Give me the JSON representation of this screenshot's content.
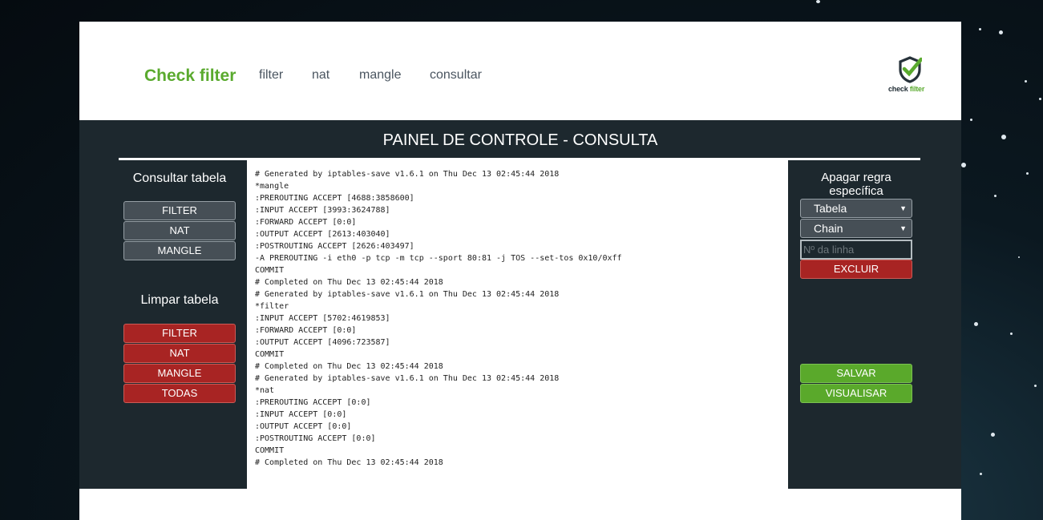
{
  "nav": {
    "brand": "Check filter",
    "links": [
      "filter",
      "nat",
      "mangle",
      "consultar"
    ],
    "logo": {
      "icon": "shield-check-icon",
      "text_dark": "check",
      "text_green": "filter"
    }
  },
  "panel": {
    "title": "PAINEL DE CONTROLE - CONSULTA",
    "consultar": {
      "heading": "Consultar tabela",
      "buttons": [
        "FILTER",
        "NAT",
        "MANGLE"
      ]
    },
    "limpar": {
      "heading": "Limpar tabela",
      "buttons": [
        "FILTER",
        "NAT",
        "MANGLE",
        "TODAS"
      ]
    },
    "apagar": {
      "heading": "Apagar regra específica",
      "tabela_select": "Tabela",
      "chain_select": "Chain",
      "linha_placeholder": "Nº da linha",
      "excluir": "EXCLUIR"
    },
    "salvar": "SALVAR",
    "visualisar": "VISUALISAR"
  },
  "output_lines": [
    "# Generated by iptables-save v1.6.1 on Thu Dec 13 02:45:44 2018",
    "*mangle",
    ":PREROUTING ACCEPT [4688:3858600]",
    ":INPUT ACCEPT [3993:3624788]",
    ":FORWARD ACCEPT [0:0]",
    ":OUTPUT ACCEPT [2613:403040]",
    ":POSTROUTING ACCEPT [2626:403497]",
    "-A PREROUTING -i eth0 -p tcp -m tcp --sport 80:81 -j TOS --set-tos 0x10/0xff",
    "COMMIT",
    "# Completed on Thu Dec 13 02:45:44 2018",
    "# Generated by iptables-save v1.6.1 on Thu Dec 13 02:45:44 2018",
    "*filter",
    ":INPUT ACCEPT [5702:4619853]",
    ":FORWARD ACCEPT [0:0]",
    ":OUTPUT ACCEPT [4096:723587]",
    "COMMIT",
    "# Completed on Thu Dec 13 02:45:44 2018",
    "# Generated by iptables-save v1.6.1 on Thu Dec 13 02:45:44 2018",
    "*nat",
    ":PREROUTING ACCEPT [0:0]",
    ":INPUT ACCEPT [0:0]",
    ":OUTPUT ACCEPT [0:0]",
    ":POSTROUTING ACCEPT [0:0]",
    "COMMIT",
    "# Completed on Thu Dec 13 02:45:44 2018"
  ],
  "colors": {
    "brand_green": "#5aaa2e",
    "panel_bg": "#1d282e",
    "danger_red": "#a82423",
    "neutral_gray": "#464f56"
  }
}
